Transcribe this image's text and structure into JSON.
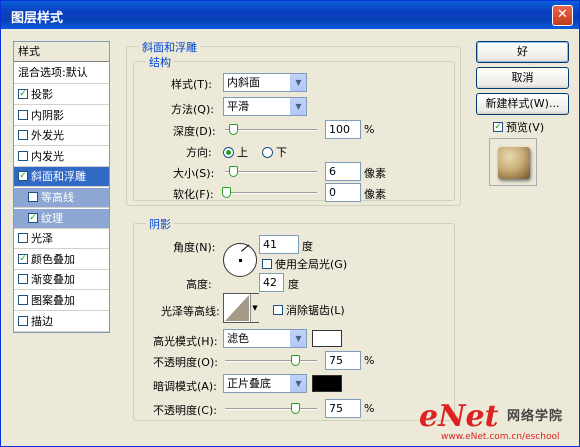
{
  "window": {
    "title": "图层样式",
    "close_symbol": "✕"
  },
  "left_panel": {
    "header": "样式",
    "blend": "混合选项:默认",
    "items": [
      {
        "label": "投影",
        "checked": true
      },
      {
        "label": "内阴影",
        "checked": false
      },
      {
        "label": "外发光",
        "checked": false
      },
      {
        "label": "内发光",
        "checked": false
      },
      {
        "label": "斜面和浮雕",
        "checked": true,
        "selected": true
      },
      {
        "label": "等高线",
        "checked": false,
        "sub": true
      },
      {
        "label": "纹理",
        "checked": true,
        "sub": true
      },
      {
        "label": "光泽",
        "checked": false
      },
      {
        "label": "颜色叠加",
        "checked": true
      },
      {
        "label": "渐变叠加",
        "checked": false
      },
      {
        "label": "图案叠加",
        "checked": false
      },
      {
        "label": "描边",
        "checked": false
      }
    ]
  },
  "bevel": {
    "group_title": "斜面和浮雕",
    "structure_title": "结构",
    "style_label": "样式(T):",
    "style_value": "内斜面",
    "method_label": "方法(Q):",
    "method_value": "平滑",
    "depth_label": "深度(D):",
    "depth_value": "100",
    "depth_unit": "%",
    "direction_label": "方向:",
    "dir_up": "上",
    "dir_down": "下",
    "size_label": "大小(S):",
    "size_value": "6",
    "size_unit": "像素",
    "soften_label": "软化(F):",
    "soften_value": "0",
    "soften_unit": "像素"
  },
  "shading": {
    "title": "阴影",
    "angle_label": "角度(N):",
    "angle_value": "41",
    "angle_unit": "度",
    "global_light": "使用全局光(G)",
    "altitude_label": "高度:",
    "altitude_value": "42",
    "altitude_unit": "度",
    "gloss_label": "光泽等高线:",
    "antialias": "消除锯齿(L)",
    "highlight_label": "高光模式(H):",
    "highlight_mode": "滤色",
    "highlight_color": "#ffffff",
    "hl_opacity_label": "不透明度(O):",
    "hl_opacity_value": "75",
    "hl_opacity_unit": "%",
    "shadow_label": "暗调模式(A):",
    "shadow_mode": "正片叠底",
    "shadow_color": "#000000",
    "sh_opacity_label": "不透明度(C):",
    "sh_opacity_value": "75",
    "sh_opacity_unit": "%"
  },
  "buttons": {
    "ok": "好",
    "cancel": "取消",
    "new_style": "新建样式(W)...",
    "preview": "预览(V)"
  },
  "watermark": {
    "brand": "eNet",
    "cn": "网络学院",
    "url": "www.eNet.com.cn/eschool"
  }
}
